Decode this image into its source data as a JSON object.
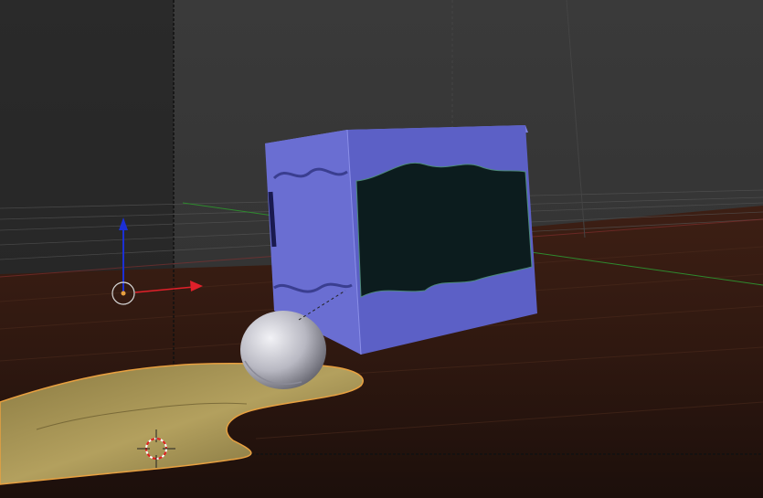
{
  "viewport": {
    "kind": "3d-viewport",
    "shading": "solid",
    "objects": [
      {
        "name": "Cube",
        "color": "#6b6fd0",
        "shape": "cube-with-wavy-cutout"
      },
      {
        "name": "Sphere",
        "color": "#c8c8d0",
        "shape": "uv-sphere"
      },
      {
        "name": "Plane",
        "color": "#b7a35e",
        "shape": "deformed-fluid-plane",
        "selected": true
      }
    ],
    "axis_colors": {
      "x": "#e0202a",
      "y": "#3cc83c",
      "z": "#1c2fd4"
    },
    "background_color": "#393939",
    "floor_color": "#3a1f14",
    "selection_outline_color": "#e8a040"
  }
}
